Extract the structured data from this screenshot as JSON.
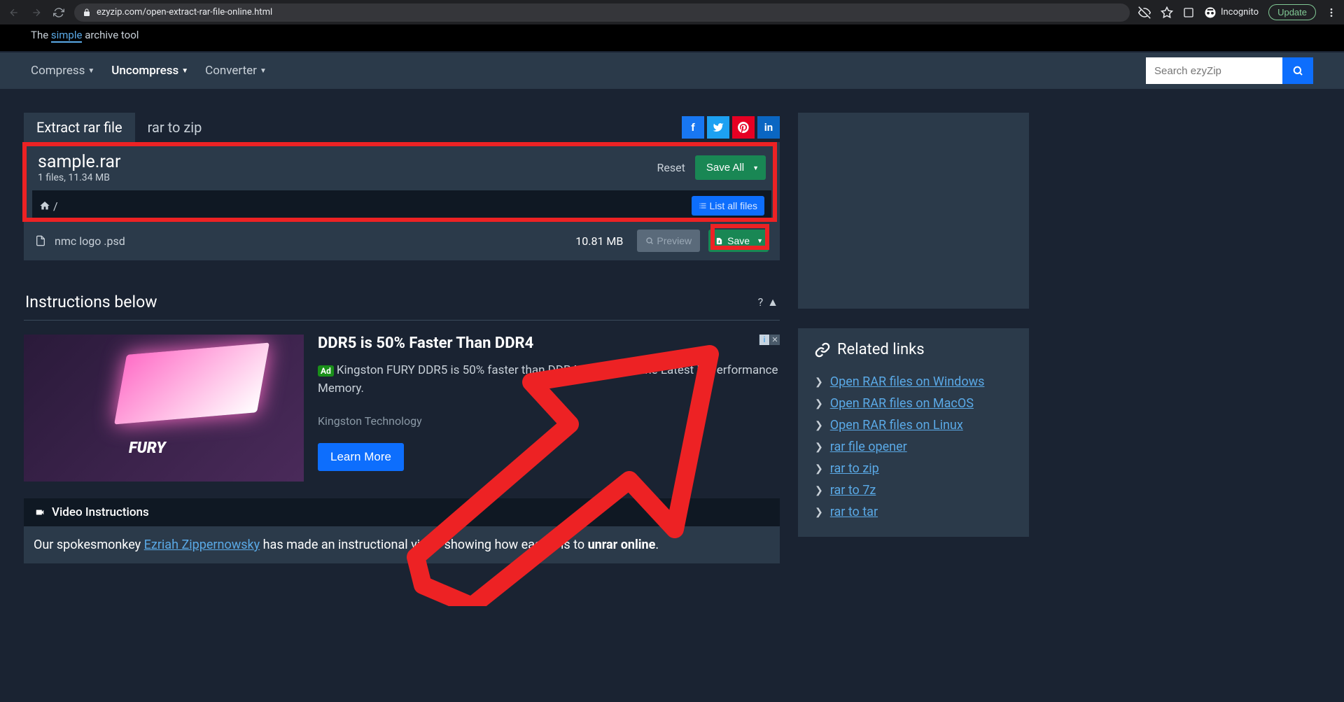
{
  "browser": {
    "url": "ezyzip.com/open-extract-rar-file-online.html",
    "incognito_label": "Incognito",
    "update_label": "Update"
  },
  "header": {
    "tagline_prefix": "The ",
    "tagline_highlight": "simple",
    "tagline_suffix": " archive tool"
  },
  "nav": {
    "items": [
      "Compress",
      "Uncompress",
      "Converter"
    ],
    "active_index": 1,
    "search_placeholder": "Search ezyZip"
  },
  "tabs": {
    "items": [
      "Extract rar file",
      "rar to zip"
    ],
    "active_index": 0
  },
  "archive": {
    "filename": "sample.rar",
    "meta": "1 files, 11.34 MB",
    "reset_label": "Reset",
    "save_all_label": "Save All",
    "breadcrumb_path": "/",
    "list_all_label": "List all files",
    "files": [
      {
        "name": "nmc logo .psd",
        "size": "10.81 MB"
      }
    ],
    "preview_label": "Preview",
    "save_label": "Save"
  },
  "instructions": {
    "heading": "Instructions below",
    "help": "?"
  },
  "ad": {
    "title": "DDR5 is 50% Faster Than DDR4",
    "badge": "Ad",
    "desc": "Kingston FURY DDR5 is 50% faster than DDR4. Check Out the Latest in Performance Memory.",
    "brand": "Kingston Technology",
    "cta": "Learn More"
  },
  "video": {
    "heading": "Video Instructions",
    "body_prefix": "Our spokesmonkey ",
    "body_link": "Ezriah Zippernowsky",
    "body_mid": " has made an instructional video showing how easy it is to ",
    "body_strong": "unrar online",
    "body_suffix": "."
  },
  "sidebar": {
    "related_heading": "Related links",
    "related_links": [
      "Open RAR files on Windows",
      "Open RAR files on MacOS",
      "Open RAR files on Linux",
      "rar file opener",
      "rar to zip",
      "rar to 7z",
      "rar to tar"
    ]
  }
}
